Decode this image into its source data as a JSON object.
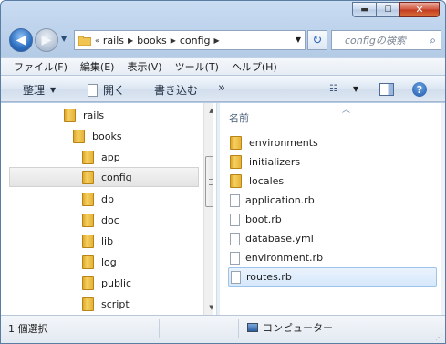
{
  "window": {
    "caption": {
      "minimize": "▬",
      "maximize": "☐",
      "close": "✕"
    }
  },
  "nav": {
    "back_glyph": "◀",
    "forward_glyph": "▶",
    "breadcrumb": [
      "«",
      "rails",
      "books",
      "config"
    ],
    "refresh_glyph": "↻",
    "search_placeholder": "configの検索",
    "search_icon": "⌕"
  },
  "menubar": {
    "items": [
      "ファイル(F)",
      "編集(E)",
      "表示(V)",
      "ツール(T)",
      "ヘルプ(H)"
    ]
  },
  "cmdbar": {
    "organize": "整理",
    "open": "開く",
    "burn": "書き込む",
    "more": "»",
    "help": "?"
  },
  "tree": {
    "items": [
      {
        "label": "rails",
        "selected": false
      },
      {
        "label": "books",
        "selected": false
      },
      {
        "label": "app",
        "selected": false
      },
      {
        "label": "config",
        "selected": true
      },
      {
        "label": "db",
        "selected": false
      },
      {
        "label": "doc",
        "selected": false
      },
      {
        "label": "lib",
        "selected": false
      },
      {
        "label": "log",
        "selected": false
      },
      {
        "label": "public",
        "selected": false
      },
      {
        "label": "script",
        "selected": false
      }
    ]
  },
  "files": {
    "column_header": "名前",
    "sort_glyph": "︿",
    "items": [
      {
        "name": "environments",
        "type": "folder",
        "selected": false
      },
      {
        "name": "initializers",
        "type": "folder",
        "selected": false
      },
      {
        "name": "locales",
        "type": "folder",
        "selected": false
      },
      {
        "name": "application.rb",
        "type": "file",
        "selected": false
      },
      {
        "name": "boot.rb",
        "type": "file",
        "selected": false
      },
      {
        "name": "database.yml",
        "type": "file",
        "selected": false
      },
      {
        "name": "environment.rb",
        "type": "file",
        "selected": false
      },
      {
        "name": "routes.rb",
        "type": "file",
        "selected": true
      }
    ]
  },
  "status": {
    "selection": "1 個選択",
    "location": "コンピューター"
  },
  "colors": {
    "folder": "#f5cf62",
    "selection": "#d6e8fb",
    "frame": "#b4cbe6"
  }
}
